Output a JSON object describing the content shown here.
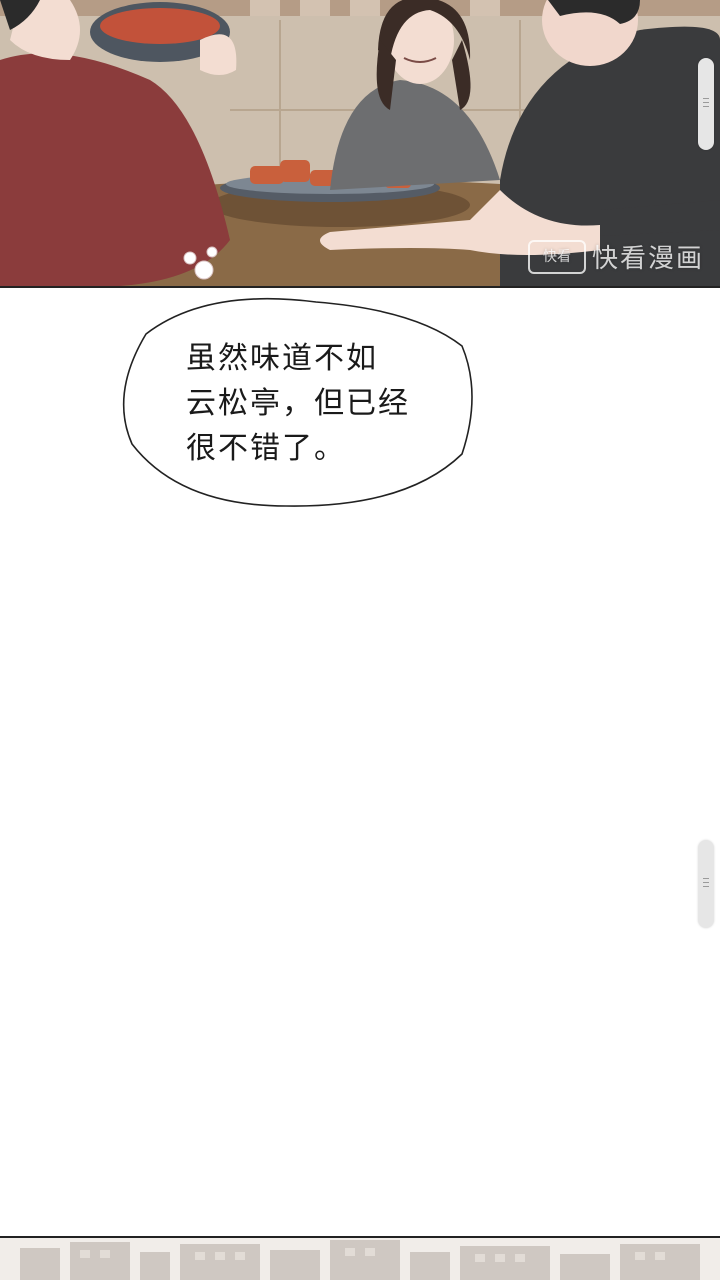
{
  "speech_bubble": {
    "lines": [
      "虽然味道不如",
      "云松亭，但已经",
      "很不错了。"
    ]
  },
  "watermark": {
    "logo_text": "快看",
    "text": "快看漫画"
  },
  "colors": {
    "wall": "#c8b9a6",
    "table": "#8a6a47",
    "shirt_red": "#8b3c3c",
    "shirt_gray": "#6d6e70",
    "shirt_dark": "#3a3b3d",
    "skin": "#f3ddd2"
  },
  "icons": {
    "scroll_handle": "grip-lines-icon"
  }
}
